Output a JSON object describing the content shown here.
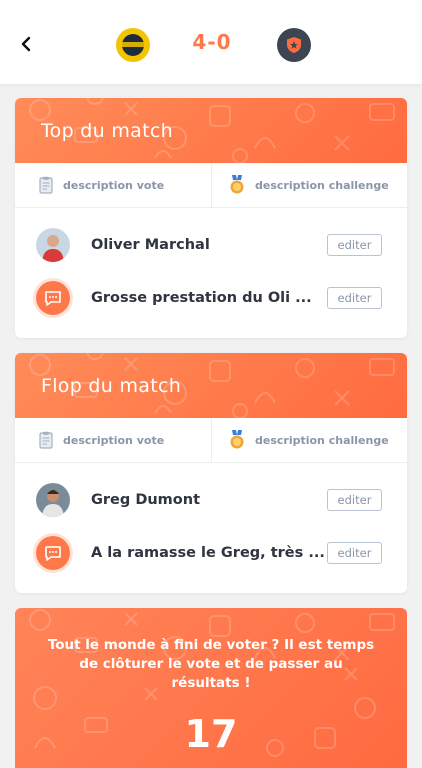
{
  "header": {
    "score": "4-0"
  },
  "cards": [
    {
      "title": "Top du match",
      "tab_vote": "description vote",
      "tab_challenge": "description challenge",
      "player_name": "Oliver Marchal",
      "comment": "Grosse prestation du Oli ...",
      "edit_label": "editer"
    },
    {
      "title": "Flop du match",
      "tab_vote": "description vote",
      "tab_challenge": "description challenge",
      "player_name": "Greg Dumont",
      "comment": "A la ramasse le Greg, très ...",
      "edit_label": "editer"
    }
  ],
  "cta": {
    "message": "Tout le monde à fini de voter ? Il est temps de clôturer le vote et de passer au résultats !",
    "count": "17"
  },
  "colors": {
    "accent": "#ff7849",
    "text": "#2e3440",
    "muted": "#8a96a8"
  }
}
